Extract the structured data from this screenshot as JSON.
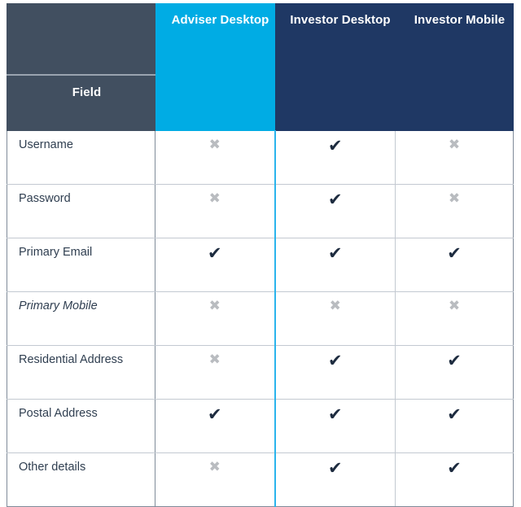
{
  "table": {
    "row_header_label": "Field",
    "columns": [
      {
        "label": "Adviser Desktop",
        "style": "accent",
        "color": "#00ace4"
      },
      {
        "label": "Investor Desktop",
        "style": "navy",
        "color": "#1f3864"
      },
      {
        "label": "Investor Mobile",
        "style": "navy",
        "color": "#1f3864"
      }
    ],
    "marks": {
      "yes_glyph": "✔",
      "no_glyph": "✖",
      "yes_name": "check-icon",
      "no_name": "cross-icon",
      "yes_color": "#1d2b3f",
      "no_color": "#b9bcc0"
    },
    "rows": [
      {
        "field": "Username",
        "italic": false,
        "values": [
          "no",
          "yes",
          "no"
        ]
      },
      {
        "field": "Password",
        "italic": false,
        "values": [
          "no",
          "yes",
          "no"
        ]
      },
      {
        "field": "Primary Email",
        "italic": false,
        "values": [
          "yes",
          "yes",
          "yes"
        ]
      },
      {
        "field": "Primary Mobile",
        "italic": true,
        "values": [
          "no",
          "no",
          "no"
        ]
      },
      {
        "field": "Residential Address",
        "italic": false,
        "values": [
          "no",
          "yes",
          "yes"
        ]
      },
      {
        "field": "Postal Address",
        "italic": false,
        "values": [
          "yes",
          "yes",
          "yes"
        ]
      },
      {
        "field": "Other details",
        "italic": false,
        "values": [
          "no",
          "yes",
          "yes"
        ]
      }
    ]
  }
}
